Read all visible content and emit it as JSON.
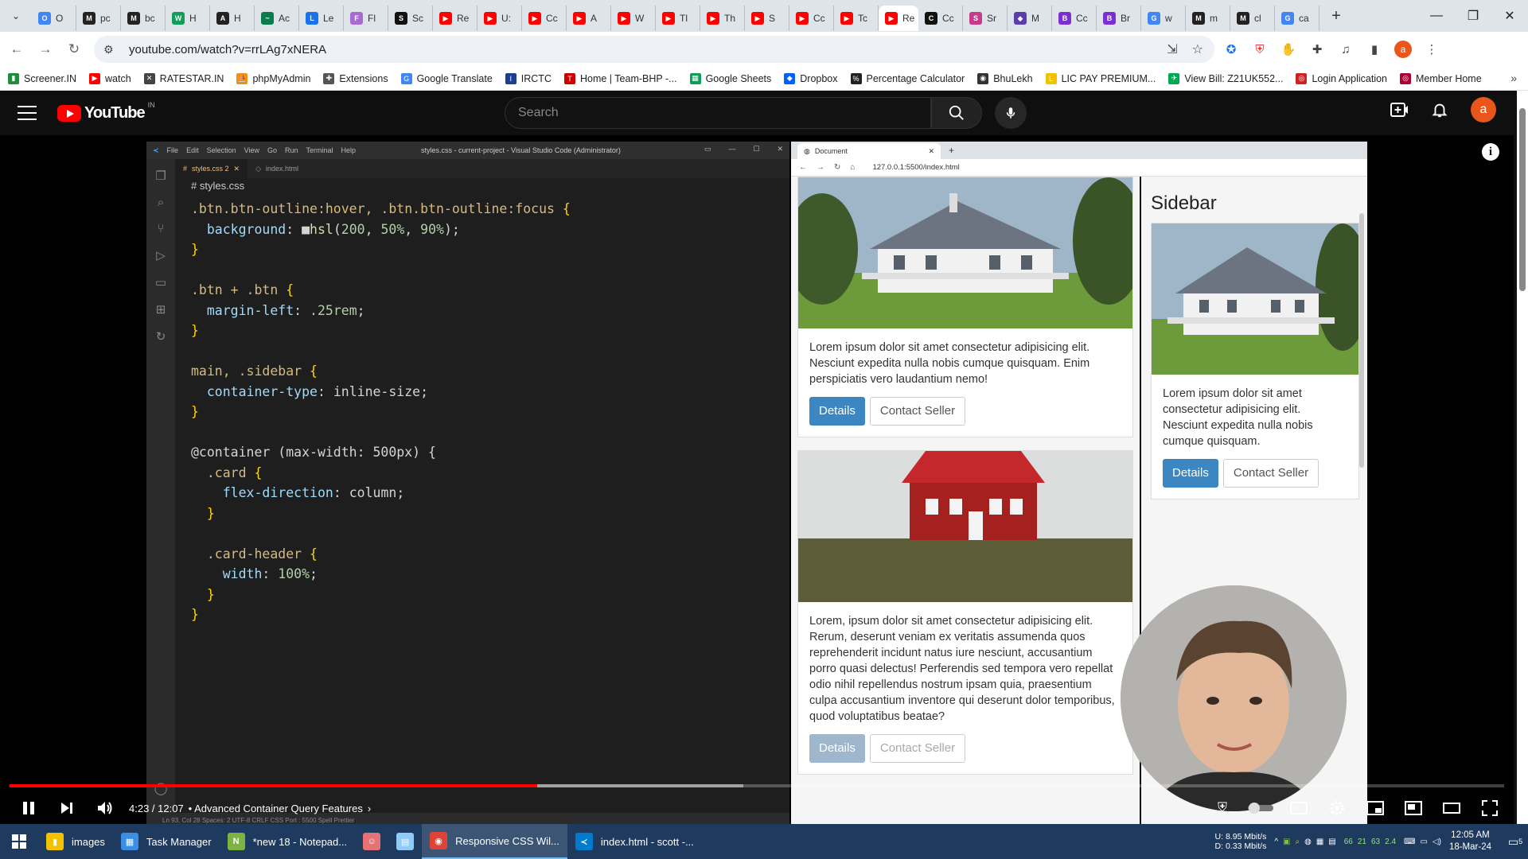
{
  "browser": {
    "tabs": [
      {
        "label": "O",
        "fav": "O",
        "color": "#4285f4"
      },
      {
        "label": "pc",
        "fav": "M",
        "color": "#222"
      },
      {
        "label": "bc",
        "fav": "M",
        "color": "#222"
      },
      {
        "label": "H",
        "fav": "W",
        "color": "#0f9d58"
      },
      {
        "label": "H",
        "fav": "A",
        "color": "#222"
      },
      {
        "label": "Ac",
        "fav": "~",
        "color": "#0a7d4f"
      },
      {
        "label": "Le",
        "fav": "L",
        "color": "#1a73e8"
      },
      {
        "label": "Fl",
        "fav": "F",
        "color": "#a86bd0"
      },
      {
        "label": "Sc",
        "fav": "S",
        "color": "#111"
      },
      {
        "label": "Re",
        "fav": "▶",
        "color": "#ff0000"
      },
      {
        "label": "U:",
        "fav": "▶",
        "color": "#ff0000"
      },
      {
        "label": "Cc",
        "fav": "▶",
        "color": "#ff0000"
      },
      {
        "label": "A",
        "fav": "▶",
        "color": "#ff0000"
      },
      {
        "label": "W",
        "fav": "▶",
        "color": "#ff0000"
      },
      {
        "label": "Tl",
        "fav": "▶",
        "color": "#ff0000"
      },
      {
        "label": "Th",
        "fav": "▶",
        "color": "#ff0000"
      },
      {
        "label": "S",
        "fav": "▶",
        "color": "#ff0000"
      },
      {
        "label": "Cc",
        "fav": "▶",
        "color": "#ff0000"
      },
      {
        "label": "Tc",
        "fav": "▶",
        "color": "#ff0000"
      },
      {
        "label": "Re",
        "fav": "▶",
        "color": "#ff0000",
        "active": true
      },
      {
        "label": "Cc",
        "fav": "C",
        "color": "#111"
      },
      {
        "label": "Sr",
        "fav": "S",
        "color": "#c83a8a"
      },
      {
        "label": "M",
        "fav": "◆",
        "color": "#5b3ea8"
      },
      {
        "label": "Cc",
        "fav": "B",
        "color": "#7b2fd0"
      },
      {
        "label": "Br",
        "fav": "B",
        "color": "#7b2fd0"
      },
      {
        "label": "w",
        "fav": "G",
        "color": "#4285f4"
      },
      {
        "label": "m",
        "fav": "M",
        "color": "#222"
      },
      {
        "label": "cl",
        "fav": "M",
        "color": "#222"
      },
      {
        "label": "ca",
        "fav": "G",
        "color": "#4285f4"
      }
    ],
    "url": "youtube.com/watch?v=rrLAg7xNERA",
    "bookmarks": [
      {
        "label": "Screener.IN",
        "color": "#1e8e3e",
        "fav": "▮"
      },
      {
        "label": "watch",
        "color": "#ff0000",
        "fav": "▶"
      },
      {
        "label": "RATESTAR.IN",
        "color": "#444",
        "fav": "✕"
      },
      {
        "label": "phpMyAdmin",
        "color": "#f29111",
        "fav": "⛵"
      },
      {
        "label": "Extensions",
        "color": "#555",
        "fav": "✚"
      },
      {
        "label": "Google Translate",
        "color": "#4285f4",
        "fav": "G"
      },
      {
        "label": "IRCTC",
        "color": "#1c3f94",
        "fav": "I"
      },
      {
        "label": "Home | Team-BHP -...",
        "color": "#c00",
        "fav": "T"
      },
      {
        "label": "Google Sheets",
        "color": "#0f9d58",
        "fav": "▦"
      },
      {
        "label": "Dropbox",
        "color": "#0061fe",
        "fav": "◆"
      },
      {
        "label": "Percentage Calculator",
        "color": "#222",
        "fav": "%"
      },
      {
        "label": "BhuLekh",
        "color": "#333",
        "fav": "◉"
      },
      {
        "label": "LIC PAY PREMIUM...",
        "color": "#f2c200",
        "fav": "L"
      },
      {
        "label": "View Bill: Z21UK552...",
        "color": "#0a5",
        "fav": "✈"
      },
      {
        "label": "Login Application",
        "color": "#c22",
        "fav": "◎"
      },
      {
        "label": "Member Home",
        "color": "#a03",
        "fav": "◎"
      }
    ]
  },
  "youtube": {
    "search_placeholder": "Search",
    "avatar_letter": "a",
    "logo_text": "YouTube",
    "country_code": "IN",
    "player": {
      "time": "4:23 / 12:07",
      "chapter": "• Advanced Container Query Features",
      "played_fraction": 0.353,
      "loaded_fraction": 0.491
    }
  },
  "vscode": {
    "title": "styles.css - current-project - Visual Studio Code (Administrator)",
    "menu": [
      "File",
      "Edit",
      "Selection",
      "View",
      "Go",
      "Run",
      "Terminal",
      "Help"
    ],
    "tabs": [
      "styles.css 2",
      "index.html"
    ],
    "breadcrumb": "# styles.css",
    "status": "Ln 93, Col 28   Spaces: 2   UTF-8   CRLF   CSS   Port : 5500   Spell   Prettier",
    "code_lines": [
      ".btn.btn-outline:hover, .btn.btn-outline:focus {",
      "  background: ■hsl(200, 50%, 90%);",
      "}",
      "",
      ".btn + .btn {",
      "  margin-left: .25rem;",
      "}",
      "",
      "main, .sidebar {",
      "  container-type: inline-size;",
      "}",
      "",
      "@container (max-width: 500px) {",
      "  .card {",
      "    flex-direction: column;",
      "  }",
      "",
      "  .card-header {",
      "    width: 100%;",
      "  }",
      "}"
    ]
  },
  "preview": {
    "tab_title": "Document",
    "url": "127.0.0.1:5500/index.html",
    "sidebar_title": "Sidebar",
    "cards": [
      {
        "text": "Lorem ipsum dolor sit amet consectetur adipisicing elit. Nesciunt expedita nulla nobis cumque quisquam. Enim perspiciatis vero laudantium nemo!",
        "primary": "Details",
        "secondary": "Contact Seller"
      },
      {
        "text": "Lorem, ipsum dolor sit amet consectetur adipisicing elit. Rerum, deserunt veniam ex veritatis assumenda quos reprehenderit incidunt natus iure nesciunt, accusantium porro quasi delectus! Perferendis sed tempora vero repellat odio nihil repellendus nostrum ipsam quia, praesentium culpa accusantium inventore qui deserunt dolor temporibus, quod voluptatibus beatae?",
        "primary": "Details",
        "secondary": "Contact Seller"
      }
    ],
    "side_card": {
      "text": "Lorem ipsum dolor sit amet consectetur adipisicing elit. Nesciunt expedita nulla nobis cumque quisquam.",
      "primary": "Details",
      "secondary": "Contact Seller"
    }
  },
  "taskbar": {
    "items": [
      {
        "label": "images",
        "color": "#f2c200",
        "icon": "▮"
      },
      {
        "label": "Task Manager",
        "color": "#3a8ee6",
        "icon": "▦"
      },
      {
        "label": "*new 18 - Notepad...",
        "color": "#7cb342",
        "icon": "N"
      },
      {
        "label": "",
        "color": "#e57373",
        "icon": "☺"
      },
      {
        "label": "",
        "color": "#90caf9",
        "icon": "▤"
      },
      {
        "label": "Responsive CSS Wil...",
        "color": "#db4437",
        "icon": "◉",
        "active": true
      },
      {
        "label": "index.html - scott -...",
        "color": "#007acc",
        "icon": "≺"
      }
    ],
    "net_up": "8.95 Mbit/s",
    "net_down": "0.33 Mbit/s",
    "net_up_label": "U:",
    "net_down_label": "D:",
    "tray_numbers": [
      "66",
      "21",
      "63",
      "2.4"
    ],
    "time": "12:05 AM",
    "date": "18-Mar-24",
    "notification_count": "5"
  }
}
